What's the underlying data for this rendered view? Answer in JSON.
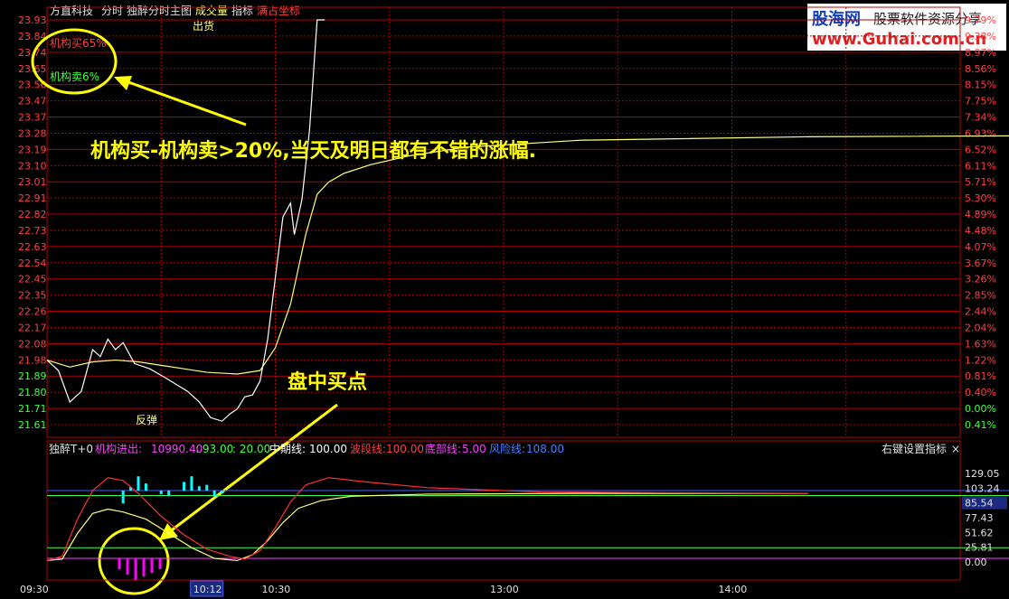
{
  "header": {
    "stock_name": "方直科技",
    "tab_intraday": "分时",
    "tab_main": "独醉分时主图",
    "tab_volume": "成交量",
    "tab_indicator": "指标",
    "tab_fullscale": "满占坐标"
  },
  "watermark": {
    "line1": "股海网",
    "line2": "股票软件资源分享",
    "line3": "www.Guhai.com.cn"
  },
  "colors": {
    "background": "#000000",
    "grid": "#b40000",
    "price_up": "#ff4040",
    "price_down": "#40ff40",
    "price_line": "#ffffff",
    "avg_line": "#ffff80",
    "annotation": "#ffff00",
    "cyan_bars": "#00ffff",
    "magenta_bars": "#ff00ff"
  },
  "annotations": {
    "main_text": "机构买-机构卖>20%,当天及明日都有不错的涨幅.",
    "buy_point_text": "盘中买点",
    "inst_buy_label": "机构买65%",
    "inst_sell_label": "机构卖6%",
    "ship_label": "出货",
    "rebound_label": "反弹"
  },
  "indicator_header": {
    "name": "独醉T+0",
    "inst_label": "机构进出:",
    "inst_value": "10990.40",
    "v2": ": 93.00",
    "v3": ": 20.00",
    "mid_label": "中期线:",
    "mid_value": "100.00",
    "wave_label": "波段线:",
    "wave_value": "100.00",
    "bottom_label": "底部线:",
    "bottom_value": "5.00",
    "risk_label": "风险线:",
    "risk_value": "108.00",
    "right_hint": "右键设置指标",
    "close_symbol": "×"
  },
  "time_axis": {
    "labels": [
      "09:30",
      "10:12",
      "10:30",
      "13:00",
      "14:00"
    ]
  },
  "chart_data": [
    {
      "type": "line",
      "title": "",
      "y_left_ticks": [
        "23.93",
        "23.84",
        "23.74",
        "23.65",
        "23.56",
        "23.47",
        "23.37",
        "23.28",
        "23.19",
        "23.10",
        "23.01",
        "22.91",
        "22.82",
        "22.73",
        "22.63",
        "22.54",
        "22.45",
        "22.35",
        "22.26",
        "22.17",
        "22.08",
        "21.98",
        "21.89",
        "21.80",
        "21.71",
        "21.61"
      ],
      "y_right_ticks": [
        "9.79%",
        "9.38%",
        "8.97%",
        "8.56%",
        "8.15%",
        "7.75%",
        "7.34%",
        "6.93%",
        "6.52%",
        "6.11%",
        "5.71%",
        "5.30%",
        "4.89%",
        "4.48%",
        "4.07%",
        "3.67%",
        "3.26%",
        "2.85%",
        "2.44%",
        "2.04%",
        "1.63%",
        "1.22%",
        "0.81%",
        "0.40%",
        "0.00%",
        "0.41%"
      ],
      "ylim": [
        21.61,
        23.93
      ],
      "series": [
        {
          "values": [
            [
              0,
              21.98
            ],
            [
              3,
              21.92
            ],
            [
              6,
              21.74
            ],
            [
              9,
              21.8
            ],
            [
              12,
              22.04
            ],
            [
              14,
              22.0
            ],
            [
              16,
              22.1
            ],
            [
              18,
              22.04
            ],
            [
              20,
              22.08
            ],
            [
              23,
              21.96
            ],
            [
              27,
              21.93
            ],
            [
              31,
              21.88
            ],
            [
              34,
              21.84
            ],
            [
              37,
              21.8
            ],
            [
              40,
              21.74
            ],
            [
              43,
              21.65
            ],
            [
              46,
              21.63
            ],
            [
              48,
              21.67
            ],
            [
              50,
              21.7
            ],
            [
              52,
              21.77
            ],
            [
              54,
              21.78
            ],
            [
              56,
              21.86
            ],
            [
              58,
              22.1
            ],
            [
              60,
              22.45
            ],
            [
              62,
              22.8
            ],
            [
              64,
              22.88
            ],
            [
              65,
              22.7
            ],
            [
              67,
              22.9
            ],
            [
              69,
              23.3
            ],
            [
              71,
              23.93
            ],
            [
              73,
              23.93
            ]
          ]
        },
        {
          "values": [
            [
              0,
              21.98
            ],
            [
              6,
              21.94
            ],
            [
              12,
              21.97
            ],
            [
              18,
              21.98
            ],
            [
              24,
              21.97
            ],
            [
              30,
              21.95
            ],
            [
              36,
              21.93
            ],
            [
              42,
              21.91
            ],
            [
              50,
              21.9
            ],
            [
              56,
              21.92
            ],
            [
              60,
              22.05
            ],
            [
              64,
              22.3
            ],
            [
              68,
              22.7
            ],
            [
              71,
              22.93
            ],
            [
              74,
              23.0
            ],
            [
              78,
              23.05
            ],
            [
              85,
              23.1
            ],
            [
              95,
              23.15
            ],
            [
              110,
              23.2
            ],
            [
              140,
              23.24
            ],
            [
              200,
              23.26
            ],
            [
              300,
              23.27
            ],
            [
              400,
              23.28
            ],
            [
              500,
              23.29
            ],
            [
              600,
              23.3
            ],
            [
              700,
              23.31
            ]
          ]
        }
      ]
    },
    {
      "type": "line",
      "title": "",
      "y_right_ticks": [
        "129.05",
        "103.24",
        "85.54",
        "77.43",
        "51.62",
        "25.81",
        "0.00"
      ],
      "ylim": [
        0,
        129.05
      ],
      "reference_lines": [
        100,
        93,
        20,
        5
      ],
      "series": [
        {
          "values": [
            [
              0,
              2
            ],
            [
              4,
              4
            ],
            [
              8,
              40
            ],
            [
              12,
              68
            ],
            [
              16,
              74
            ],
            [
              20,
              70
            ],
            [
              26,
              60
            ],
            [
              32,
              40
            ],
            [
              38,
              20
            ],
            [
              44,
              5
            ],
            [
              50,
              2
            ],
            [
              54,
              10
            ],
            [
              58,
              30
            ],
            [
              62,
              55
            ],
            [
              66,
              75
            ],
            [
              72,
              86
            ],
            [
              80,
              92
            ],
            [
              100,
              95
            ],
            [
              140,
              96
            ],
            [
              200,
              96
            ]
          ]
        },
        {
          "values": [
            [
              0,
              2
            ],
            [
              4,
              8
            ],
            [
              8,
              60
            ],
            [
              12,
              100
            ],
            [
              16,
              118
            ],
            [
              20,
              114
            ],
            [
              24,
              96
            ],
            [
              30,
              64
            ],
            [
              36,
              38
            ],
            [
              42,
              18
            ],
            [
              48,
              8
            ],
            [
              52,
              4
            ],
            [
              56,
              16
            ],
            [
              60,
              48
            ],
            [
              64,
              84
            ],
            [
              68,
              108
            ],
            [
              74,
              118
            ],
            [
              84,
              112
            ],
            [
              100,
              104
            ],
            [
              130,
              98
            ],
            [
              160,
              97
            ],
            [
              200,
              96
            ]
          ]
        }
      ],
      "cyan_bars": [
        [
          20,
          82
        ],
        [
          22,
          105
        ],
        [
          24,
          120
        ],
        [
          26,
          110
        ],
        [
          28,
          100
        ],
        [
          30,
          95
        ],
        [
          32,
          92
        ],
        [
          34,
          100
        ],
        [
          36,
          112
        ],
        [
          38,
          120
        ],
        [
          40,
          106
        ],
        [
          42,
          108
        ],
        [
          44,
          92
        ],
        [
          46,
          96
        ]
      ],
      "magenta_bars": [
        [
          0,
          12
        ],
        [
          2,
          18
        ],
        [
          4,
          24
        ],
        [
          6,
          20
        ],
        [
          8,
          16
        ],
        [
          10,
          12
        ]
      ]
    }
  ]
}
